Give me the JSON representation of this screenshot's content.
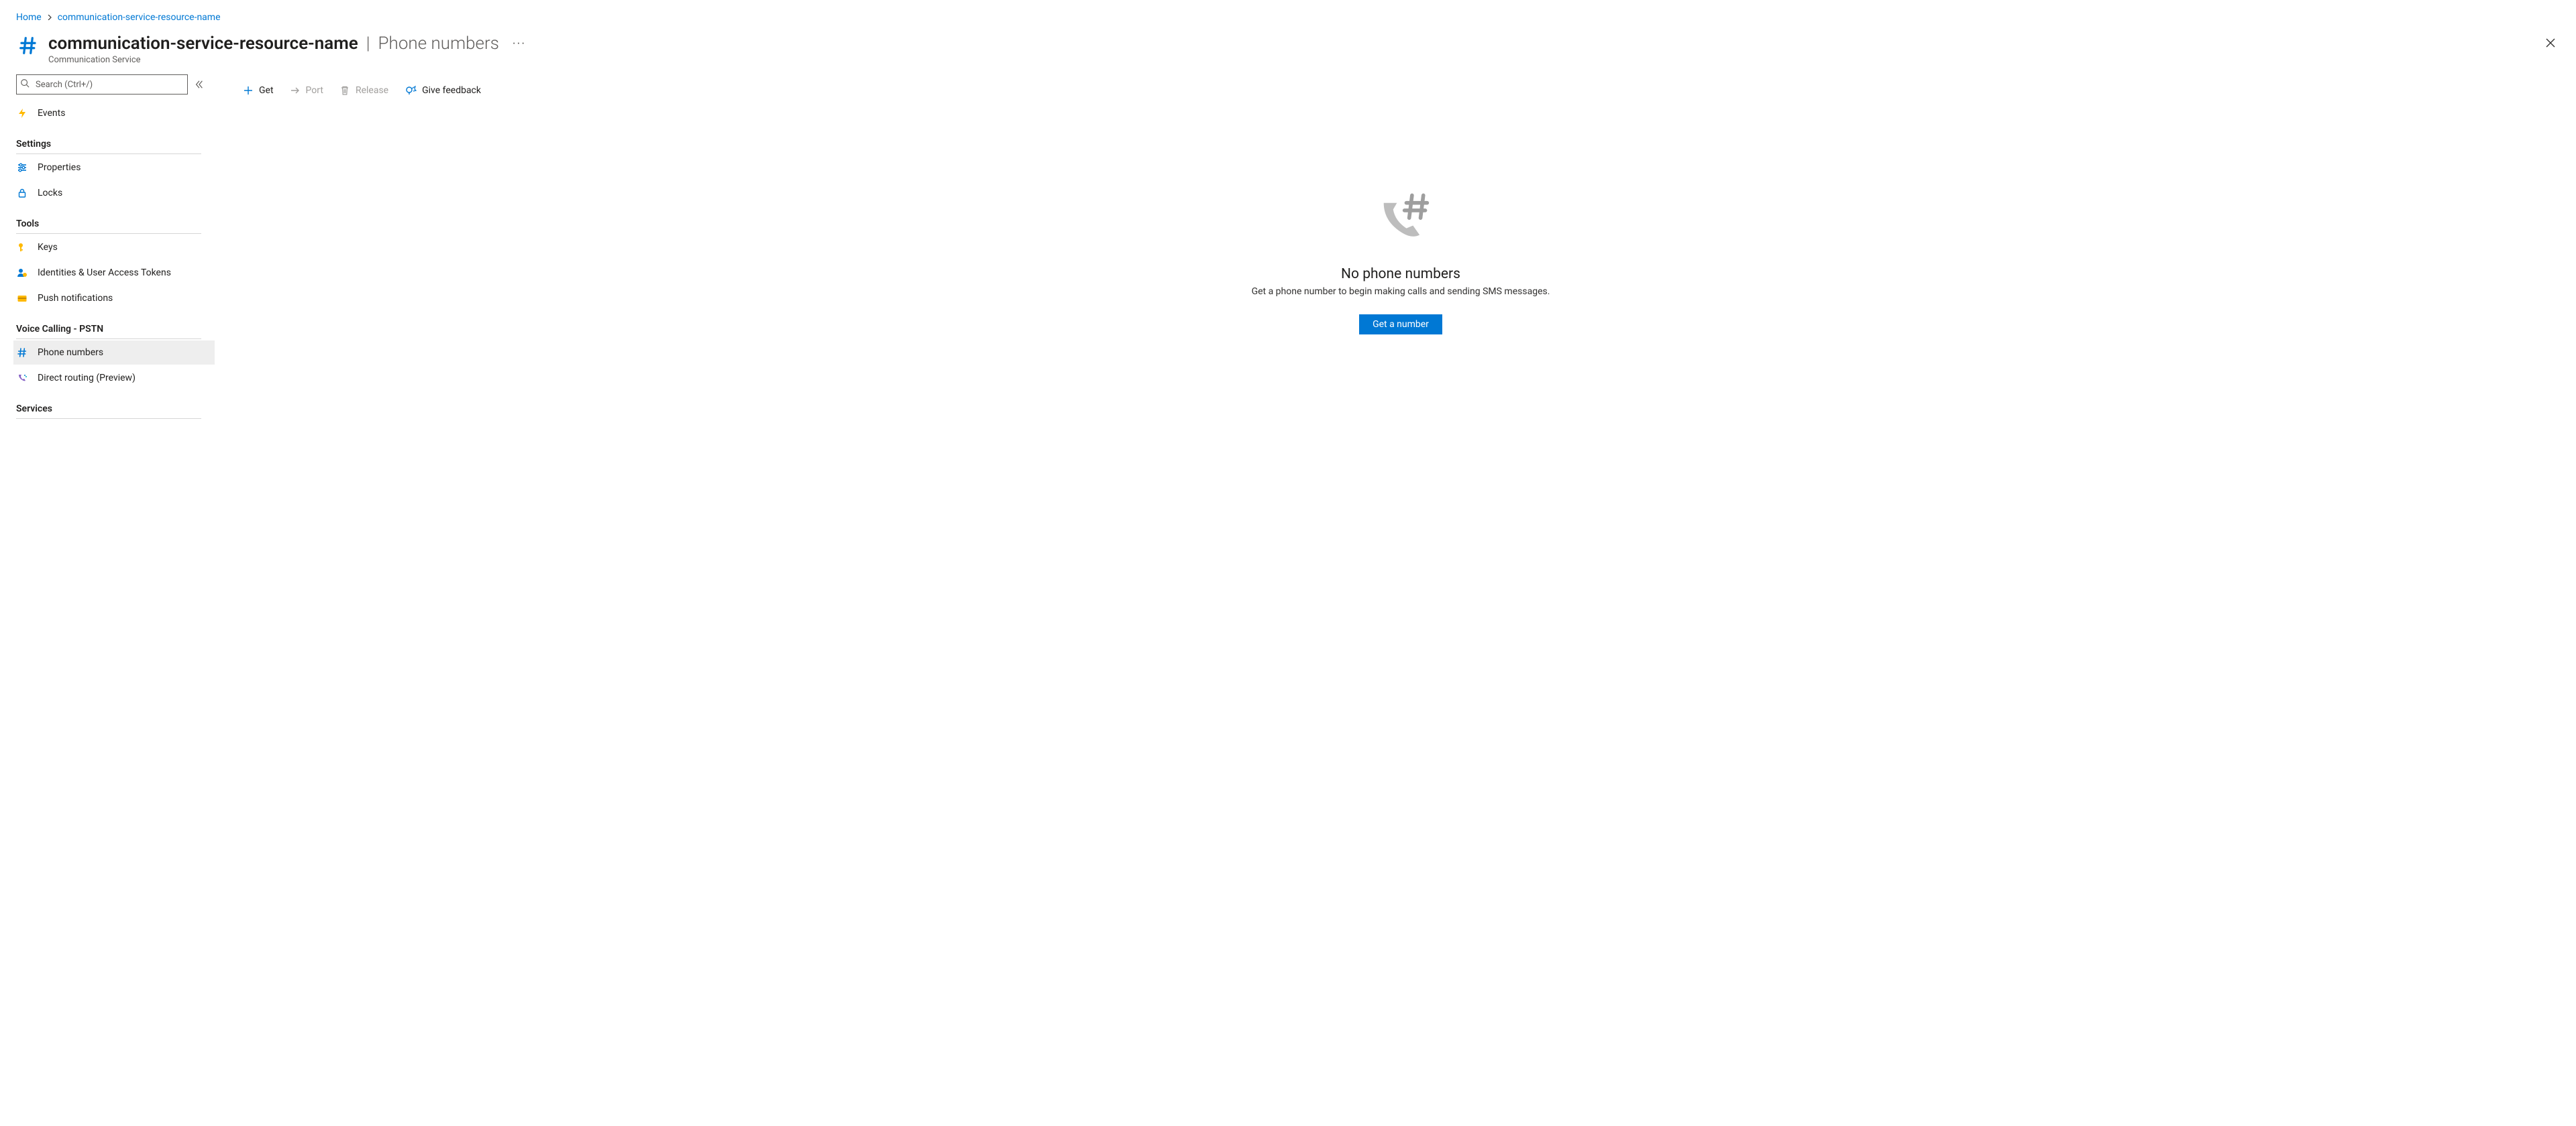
{
  "breadcrumb": {
    "home": "Home",
    "resource": "communication-service-resource-name"
  },
  "header": {
    "resource_name": "communication-service-resource-name",
    "separator": "|",
    "page": "Phone numbers",
    "resource_type": "Communication Service"
  },
  "sidebar": {
    "search_placeholder": "Search (Ctrl+/)",
    "events": "Events",
    "group_settings": "Settings",
    "properties": "Properties",
    "locks": "Locks",
    "group_tools": "Tools",
    "keys": "Keys",
    "identities": "Identities & User Access Tokens",
    "push": "Push notifications",
    "group_voice": "Voice Calling - PSTN",
    "phone_numbers": "Phone numbers",
    "direct_routing": "Direct routing (Preview)",
    "group_services": "Services"
  },
  "toolbar": {
    "get": "Get",
    "port": "Port",
    "release": "Release",
    "feedback": "Give feedback"
  },
  "empty": {
    "title": "No phone numbers",
    "text": "Get a phone number to begin making calls and sending SMS messages.",
    "button": "Get a number"
  }
}
